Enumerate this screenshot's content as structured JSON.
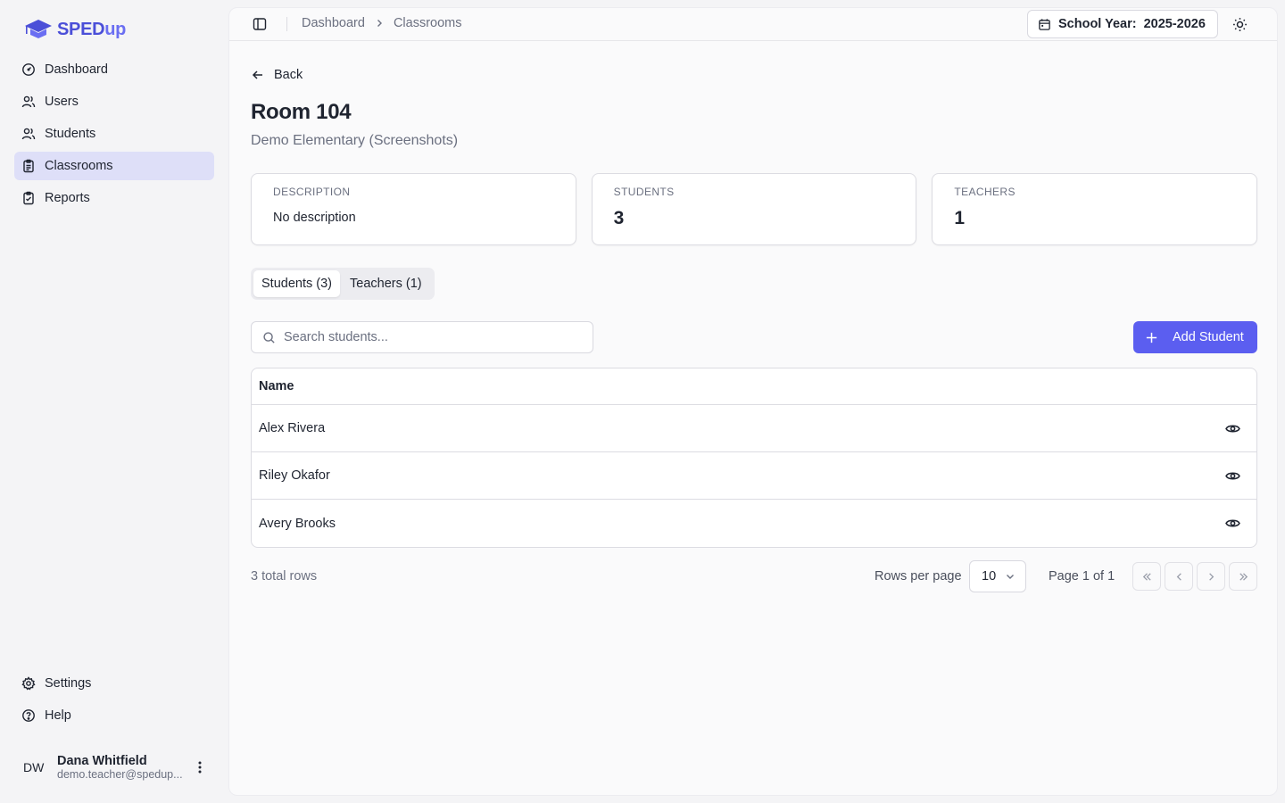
{
  "app": {
    "logo_main": "SPED",
    "logo_suffix": "up"
  },
  "sidebar": {
    "items": [
      {
        "label": "Dashboard",
        "icon": "gauge-icon"
      },
      {
        "label": "Users",
        "icon": "users-icon"
      },
      {
        "label": "Students",
        "icon": "students-icon"
      },
      {
        "label": "Classrooms",
        "icon": "clipboard-icon",
        "active": true
      },
      {
        "label": "Reports",
        "icon": "report-icon"
      }
    ],
    "bottom_items": [
      {
        "label": "Settings",
        "icon": "gear-icon"
      },
      {
        "label": "Help",
        "icon": "help-icon"
      }
    ],
    "user": {
      "initials": "DW",
      "name": "Dana Whitfield",
      "email": "demo.teacher@spedup..."
    }
  },
  "topbar": {
    "breadcrumb": [
      "Dashboard",
      "Classrooms"
    ],
    "school_year_label": "School Year:",
    "school_year_value": "2025-2026"
  },
  "page": {
    "back_label": "Back",
    "title": "Room 104",
    "subtitle": "Demo Elementary (Screenshots)"
  },
  "cards": {
    "description": {
      "label": "Description",
      "value": "No description"
    },
    "students": {
      "label": "Students",
      "value": "3"
    },
    "teachers": {
      "label": "Teachers",
      "value": "1"
    }
  },
  "tabs": [
    "Students (3)",
    "Teachers (1)"
  ],
  "search": {
    "placeholder": "Search students..."
  },
  "add_button": "Add Student",
  "table": {
    "header": "Name",
    "rows": [
      "Alex Rivera",
      "Riley Okafor",
      "Avery Brooks"
    ]
  },
  "footer": {
    "total": "3 total rows",
    "rows_per_page_label": "Rows per page",
    "rows_per_page_value": "10",
    "page_info": "Page 1 of 1"
  },
  "colors": {
    "accent": "#5b5ef0",
    "active_nav": "#dedff8",
    "logo": "#4b4fd8"
  }
}
